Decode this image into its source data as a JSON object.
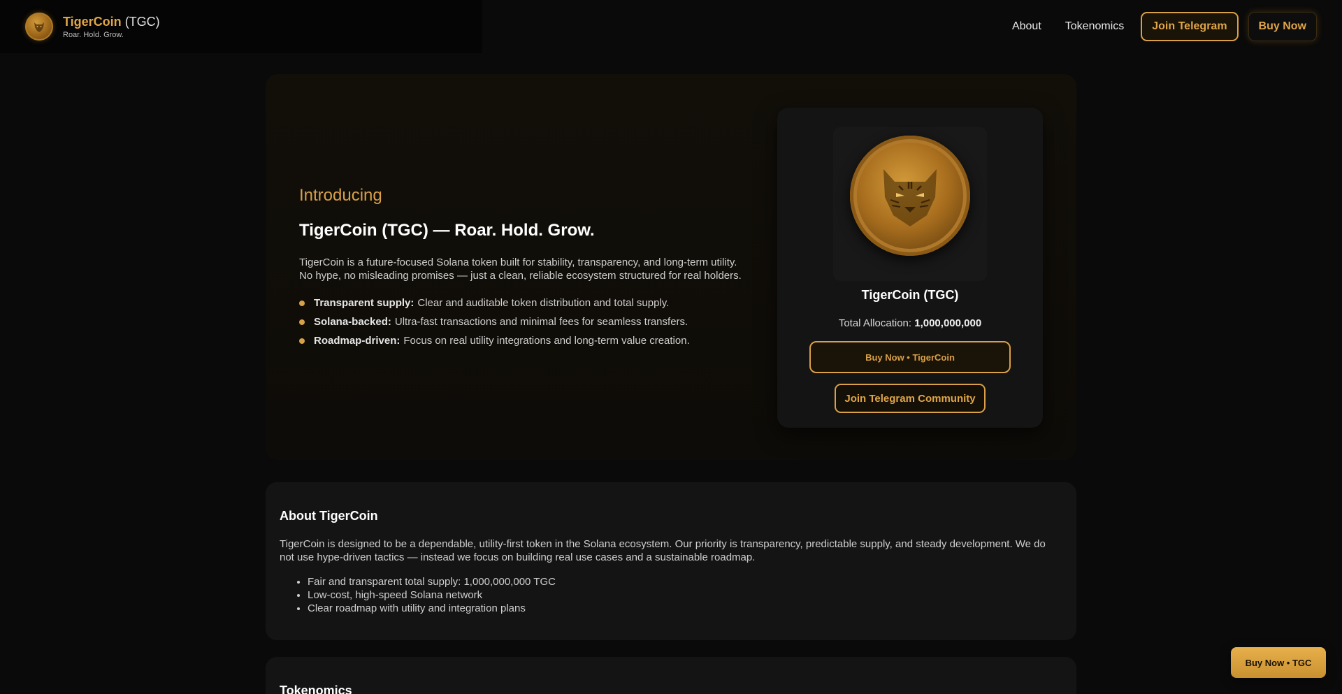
{
  "header": {
    "brand_name": "TigerCoin",
    "brand_ticker": "(TGC)",
    "tagline": "Roar. Hold. Grow.",
    "nav": [
      {
        "label": "About"
      },
      {
        "label": "Tokenomics"
      }
    ],
    "join_telegram_label": "Join Telegram",
    "buy_now_label": "Buy Now"
  },
  "hero": {
    "eyebrow": "Introducing",
    "title": "TigerCoin (TGC) — Roar. Hold. Grow.",
    "description": "TigerCoin is a future-focused Solana token built for stability, transparency, and long-term utility. No hype, no misleading promises — just a clean, reliable ecosystem structured for real holders.",
    "features": [
      {
        "title": "Transparent supply:",
        "text": "Clear and auditable token distribution and total supply."
      },
      {
        "title": "Solana-backed:",
        "text": "Ultra-fast transactions and minimal fees for seamless transfers."
      },
      {
        "title": "Roadmap-driven:",
        "text": "Focus on real utility integrations and long-term value creation."
      }
    ]
  },
  "card": {
    "title": "TigerCoin (TGC)",
    "allocation_label": "Total Allocation:",
    "allocation_value": "1,000,000,000",
    "buy_label": "Buy Now • TigerCoin",
    "telegram_label": "Join Telegram Community"
  },
  "about": {
    "title": "About TigerCoin",
    "description": "TigerCoin is designed to be a dependable, utility-first token in the Solana ecosystem. Our priority is transparency, predictable supply, and steady development. We do not use hype-driven tactics — instead we focus on building real use cases and a sustainable roadmap.",
    "points": [
      "Fair and transparent total supply: 1,000,000,000 TGC",
      "Low-cost, high-speed Solana network",
      "Clear roadmap with utility and integration plans"
    ]
  },
  "tokenomics": {
    "title": "Tokenomics"
  },
  "floating_buy_label": "Buy Now • TGC",
  "colors": {
    "accent": "#d9a047",
    "background": "#0a0a0a",
    "card": "#141414"
  },
  "icons": {
    "logo": "tiger-coin-icon",
    "hero_coin": "tiger-coin-icon"
  }
}
